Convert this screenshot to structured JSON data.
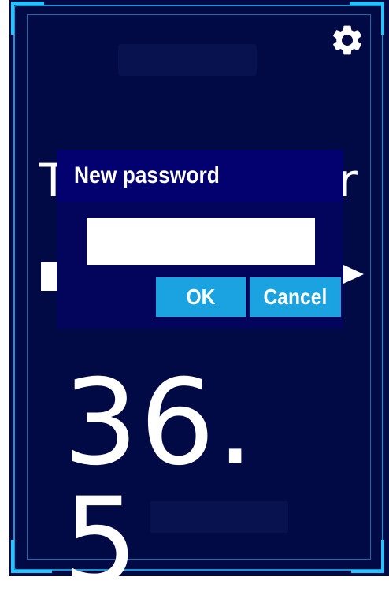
{
  "app": {
    "temperature_value": "36. 5",
    "title_fragment_left": "T",
    "title_fragment_right": "r"
  },
  "icons": {
    "settings": "gear-icon",
    "next": "right-triangle-arrow-icon"
  },
  "dialog": {
    "title": "New password",
    "input_value": "",
    "ok_label": "OK",
    "cancel_label": "Cancel"
  },
  "colors": {
    "background": "#020a45",
    "frame_accent": "#25c4ff",
    "dialog_bg": "#03045c",
    "dialog_title_bg": "#030070",
    "button_bg": "#1aa3e0",
    "text": "#ffffff"
  }
}
